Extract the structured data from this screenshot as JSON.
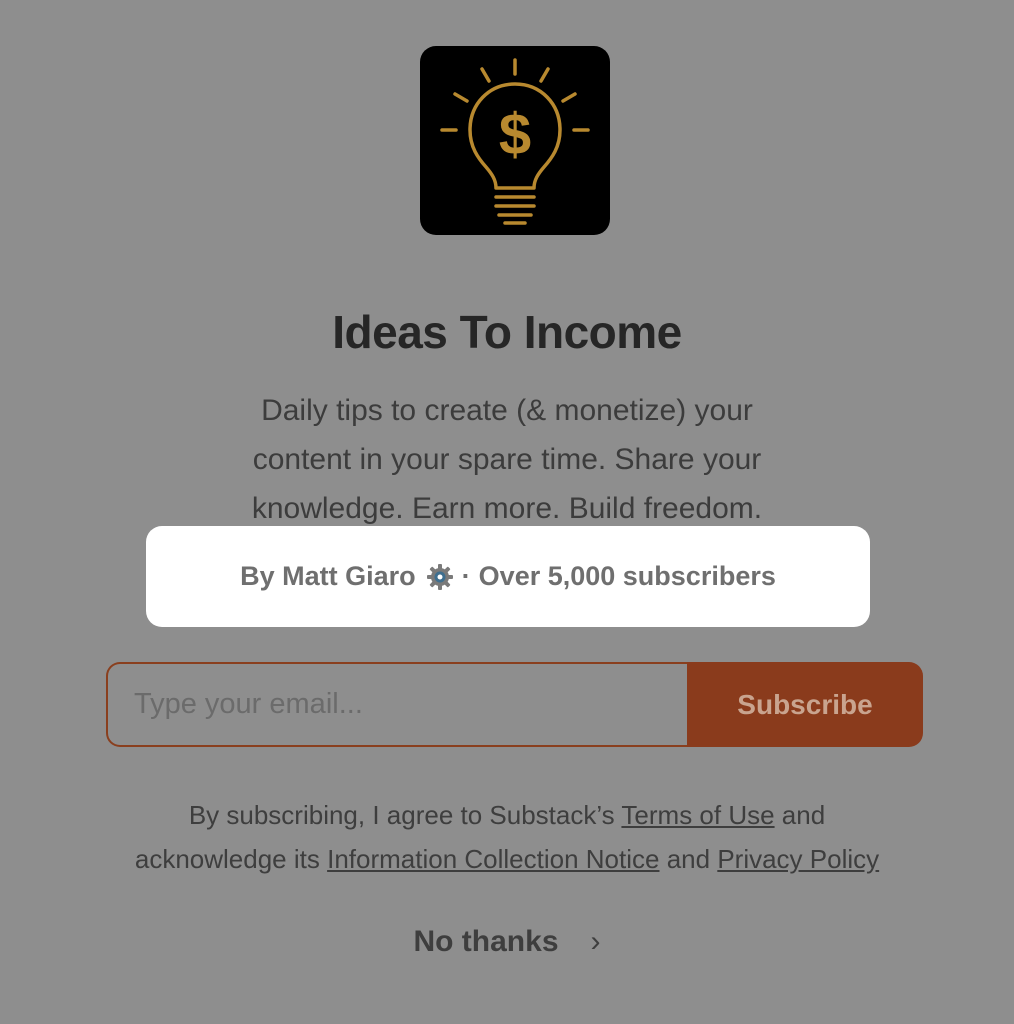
{
  "publication": {
    "logo_icon": "lightbulb-dollar-icon",
    "title": "Ideas To Income",
    "description_lines": [
      "Daily tips to create (& monetize) your",
      "content in your spare time. Share your",
      "knowledge. Earn more. Build freedom."
    ]
  },
  "author": {
    "by": "By Matt Giaro",
    "separator": "·",
    "subscribers": "Over 5,000 subscribers",
    "badge_icon": "gear-icon"
  },
  "form": {
    "email_placeholder": "Type your email...",
    "subscribe_label": "Subscribe"
  },
  "legal": {
    "part1": "By subscribing, I agree to Substack’s ",
    "terms_link": "Terms of Use",
    "part2": " and",
    "part3": "acknowledge its ",
    "info_link": "Information Collection Notice",
    "part4": " and ",
    "privacy_link": "Privacy Policy"
  },
  "dismiss": {
    "label": "No thanks",
    "chevron": "›"
  },
  "colors": {
    "overlay_bg": "#8e8e8e",
    "accent": "#8a3b1c",
    "logo_gold": "#b8892f"
  }
}
